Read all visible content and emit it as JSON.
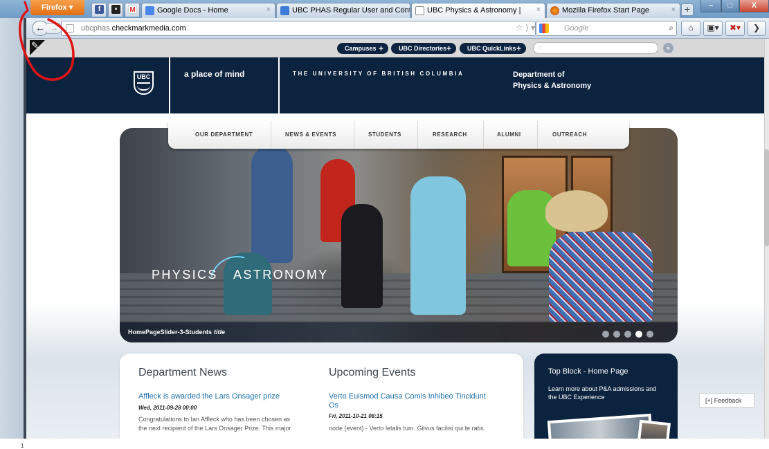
{
  "browser": {
    "menu_label": "Firefox",
    "tabs": [
      {
        "title": "Google Docs - Home"
      },
      {
        "title": "UBC PHAS Regular User and Cont..."
      },
      {
        "title": "UBC Physics & Astronomy |"
      },
      {
        "title": "Mozilla Firefox Start Page"
      }
    ],
    "url_prefix": "ubcphas.",
    "url_domain": "checkmarkmedia.com",
    "search_placeholder": "Google",
    "close_glyph": "×",
    "newtab_glyph": "+",
    "back_glyph": "←",
    "forward_glyph": "→",
    "home_glyph": "⌂",
    "search_glyph": "⌕",
    "window_minimize": "–",
    "window_maximize": "□",
    "window_close": "X",
    "more_glyph": "❯",
    "url_icons": "☆ ⟩ ▾ C"
  },
  "ubc_top": {
    "pills": [
      {
        "label": "Campuses",
        "glyph": "+"
      },
      {
        "label": "UBC Directories",
        "glyph": "+"
      },
      {
        "label": "UBC QuickLinks",
        "glyph": "+"
      }
    ],
    "go_glyph": "»"
  },
  "header": {
    "crest_text": "UBC",
    "tagline": "a place of mind",
    "university": "THE UNIVERSITY OF BRITISH COLUMBIA",
    "dept_line1": "Department of",
    "dept_line2": "Physics & Astronomy"
  },
  "nav": {
    "items": [
      "OUR DEPARTMENT",
      "NEWS & EVENTS",
      "STUDENTS",
      "RESEARCH",
      "ALUMNI",
      "OUTREACH"
    ]
  },
  "hero": {
    "title_left": "PHYSICS",
    "title_right": "ASTRONOMY",
    "caption": "HomePageSlider-3-Students",
    "caption_suffix": "title",
    "slide_count": 5,
    "active_slide": 4
  },
  "news": {
    "title": "Department News",
    "item_title": "Affleck is awarded the Lars Onsager prize",
    "item_date": "Wed, 2011-09-28 00:00",
    "item_text_1": "Congratulations to Ian Affleck who has been chosen as",
    "item_text_2": "the next recipient of the Lars Onsager Prize. This major"
  },
  "events": {
    "title": "Upcoming Events",
    "item_title_1": "Verto Euismod Causa Comis Inhibeo Tincidunt",
    "item_title_2": "Os",
    "item_date": "Fri, 2011-10-21 08:15",
    "item_text_1": "node (event) - Verto letalis tum. Gilvus facilisi qui te ratis."
  },
  "top_block": {
    "title": "Top Block - Home Page",
    "text": "Learn more about P&A admissions and the UBC Experience"
  },
  "feedback": {
    "label": "[+] Feedback"
  },
  "sidebar": {
    "index_label": "1"
  },
  "colors": {
    "ubc_navy": "#0c2340",
    "link_blue": "#1b6fa8",
    "annotation_red": "#e01414"
  }
}
